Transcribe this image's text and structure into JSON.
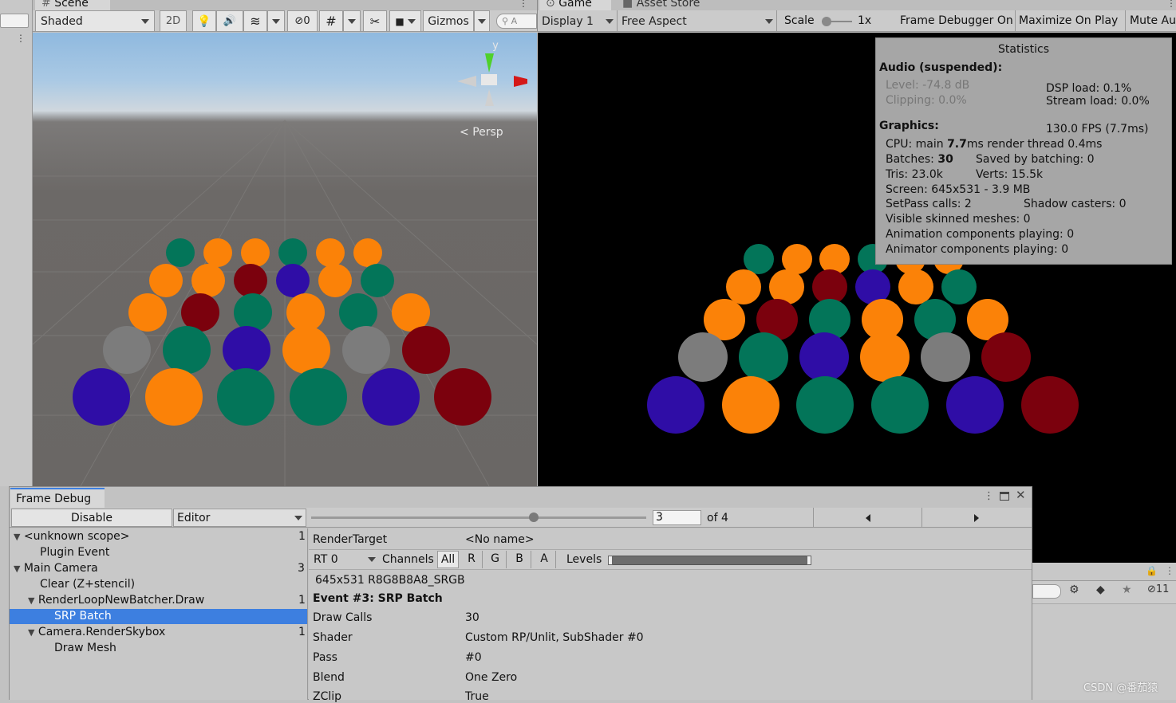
{
  "scene_tab": {
    "title": "Scene"
  },
  "scene_toolbar": {
    "shading_mode": "Shaded",
    "mode_2d": "2D",
    "hidden_count": "0",
    "gizmos": "Gizmos",
    "search_placeholder": "A"
  },
  "scene_view": {
    "projection": "Persp",
    "axis_y": "y"
  },
  "game_tabs": {
    "game": "Game",
    "asset_store": "Asset Store"
  },
  "game_toolbar": {
    "display": "Display 1",
    "aspect": "Free Aspect",
    "scale_label": "Scale",
    "scale_value": "1x",
    "frame_debugger": "Frame Debugger On",
    "maximize": "Maximize On Play",
    "mute": "Mute Au"
  },
  "statistics": {
    "title": "Statistics",
    "audio_header": "Audio (suspended):",
    "level": "Level: -74.8 dB",
    "clipping": "Clipping: 0.0%",
    "dsp_load": "DSP load: 0.1%",
    "stream_load": "Stream load: 0.0%",
    "graphics_header": "Graphics:",
    "fps": "130.0 FPS (7.7ms)",
    "cpu_prefix": "CPU: main ",
    "cpu_main": "7.7",
    "cpu_suffix": "ms  render thread 0.4ms",
    "batches_label": "Batches: ",
    "batches_value": "30",
    "saved_by_batching": "Saved by batching: 0",
    "tris": "Tris: 23.0k",
    "verts": "Verts: 15.5k",
    "screen": "Screen: 645x531 - 3.9 MB",
    "setpass": "SetPass calls: 2",
    "shadow_casters": "Shadow casters: 0",
    "skinned_meshes": "Visible skinned meshes: 0",
    "animation_components": "Animation components playing: 0",
    "animator_components": "Animator components playing: 0"
  },
  "frame_debug": {
    "tab_title": "Frame Debug",
    "disable_button": "Disable",
    "target": "Editor",
    "event_index": "3",
    "event_total": "of 4",
    "hierarchy": [
      {
        "label": "<unknown scope>",
        "count": "1"
      },
      {
        "label": "Plugin Event",
        "count": ""
      },
      {
        "label": "Main Camera",
        "count": "3"
      },
      {
        "label": "Clear (Z+stencil)",
        "count": ""
      },
      {
        "label": "RenderLoopNewBatcher.Draw",
        "count": "1"
      },
      {
        "label": "SRP Batch",
        "count": ""
      },
      {
        "label": "Camera.RenderSkybox",
        "count": "1"
      },
      {
        "label": "Draw Mesh",
        "count": ""
      }
    ],
    "render_target_label": "RenderTarget",
    "render_target_value": "<No name>",
    "rt": "RT 0",
    "channels_label": "Channels",
    "channels": [
      "All",
      "R",
      "G",
      "B",
      "A"
    ],
    "levels_label": "Levels",
    "format": "645x531 R8G8B8A8_SRGB",
    "event_title": "Event #3: SRP Batch",
    "props": [
      {
        "label": "Draw Calls",
        "value": "30"
      },
      {
        "label": "Shader",
        "value": "Custom RP/Unlit, SubShader #0"
      },
      {
        "label": "Pass",
        "value": "#0"
      },
      {
        "label": "Blend",
        "value": "One Zero"
      },
      {
        "label": "ZClip",
        "value": "True"
      }
    ]
  },
  "inspector_strip": {
    "hidden_count": "11"
  },
  "watermark": "CSDN @番茄猿",
  "colors": {
    "teal": "#037559",
    "orange": "#fb8208",
    "dark_red": "#7b010d",
    "indigo": "#2f0da6",
    "grey": "#7c7c7c",
    "selection": "#3d7fe0"
  },
  "sphere_rows": [
    [
      "teal",
      "orange",
      "orange",
      "teal",
      "orange",
      "orange"
    ],
    [
      "orange",
      "orange",
      "dark_red",
      "indigo",
      "orange",
      "teal"
    ],
    [
      "orange",
      "dark_red",
      "teal",
      "orange",
      "teal",
      "orange"
    ],
    [
      "grey",
      "teal",
      "indigo",
      "orange",
      "grey",
      "dark_red"
    ],
    [
      "indigo",
      "orange",
      "teal",
      "teal",
      "indigo",
      "dark_red"
    ]
  ]
}
